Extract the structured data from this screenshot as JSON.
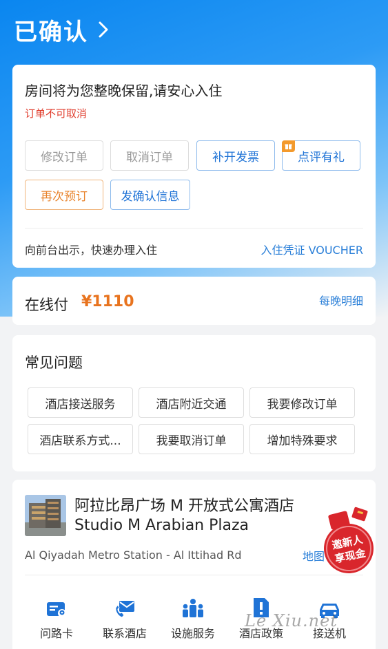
{
  "header": {
    "title": "已确认"
  },
  "booking": {
    "notice": "房间将为您整晚保留,请安心入住",
    "cancel_policy": "订单不可取消",
    "buttons": {
      "modify": "修改订单",
      "cancel": "取消订单",
      "invoice": "补开发票",
      "review": "点评有礼",
      "rebook": "再次预订",
      "send_confirmation": "发确认信息"
    },
    "footer_text": "向前台出示，快速办理入住",
    "voucher_link": "入住凭证 VOUCHER"
  },
  "payment": {
    "label": "在线付",
    "price": "¥1110",
    "detail_link": "每晚明细"
  },
  "faq": {
    "title": "常见问题",
    "items": [
      "酒店接送服务",
      "酒店附近交通",
      "我要修改订单",
      "酒店联系方式...",
      "我要取消订单",
      "增加特殊要求"
    ]
  },
  "hotel": {
    "name_cn": "阿拉比昂广场 M 开放式公寓酒店",
    "name_en": "Studio M Arabian Plaza",
    "address": "Al Qiyadah Metro Station - Al Ittihad Rd",
    "map_label": "地图"
  },
  "services": [
    {
      "label": "问路卡",
      "icon": "direction-card-icon"
    },
    {
      "label": "联系酒店",
      "icon": "phone-icon"
    },
    {
      "label": "设施服务",
      "icon": "people-icon"
    },
    {
      "label": "酒店政策",
      "icon": "policy-icon"
    },
    {
      "label": "接送机",
      "icon": "car-icon"
    }
  ],
  "promo": {
    "line1": "邀新人",
    "line2": "享现金"
  },
  "watermark": "Le Xiu.net",
  "colors": {
    "brand_blue": "#0a86f0",
    "link_blue": "#2a7fd8",
    "price_orange": "#e8731e",
    "warning_red": "#e03c2c",
    "promo_red": "#d9262c"
  }
}
